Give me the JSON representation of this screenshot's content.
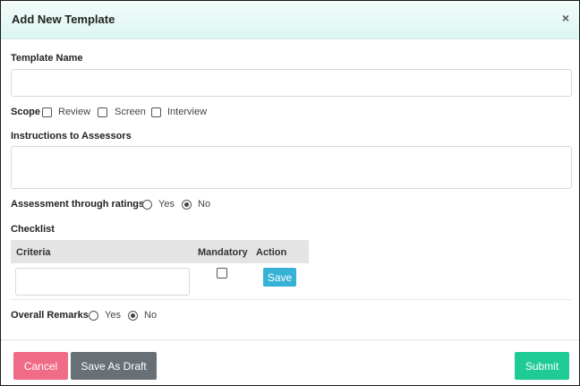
{
  "modal": {
    "title": "Add New Template",
    "close_symbol": "×"
  },
  "template_name": {
    "label": "Template Name",
    "value": "",
    "placeholder": ""
  },
  "scope": {
    "label": "Scope",
    "options": [
      {
        "label": "Review",
        "checked": false
      },
      {
        "label": "Screen",
        "checked": false
      },
      {
        "label": "Interview",
        "checked": false
      }
    ]
  },
  "instructions": {
    "label": "Instructions to Assessors",
    "value": "",
    "placeholder": ""
  },
  "assessment_ratings": {
    "label": "Assessment through ratings",
    "options": [
      {
        "label": "Yes",
        "selected": false
      },
      {
        "label": "No",
        "selected": true
      }
    ]
  },
  "checklist": {
    "label": "Checklist",
    "columns": [
      "Criteria",
      "Mandatory",
      "Action"
    ],
    "rows": [
      {
        "criteria": "",
        "mandatory": false,
        "action_label": "Save"
      }
    ]
  },
  "overall_remarks": {
    "label": "Overall Remarks",
    "options": [
      {
        "label": "Yes",
        "selected": false
      },
      {
        "label": "No",
        "selected": true
      }
    ]
  },
  "footer": {
    "cancel_label": "Cancel",
    "draft_label": "Save As Draft",
    "submit_label": "Submit"
  },
  "colors": {
    "header_bg": "#dcf6f1",
    "cancel": "#f06c86",
    "draft": "#686f75",
    "submit": "#1fcb95",
    "save": "#35b2d6",
    "table_header": "#e4e4e4"
  }
}
